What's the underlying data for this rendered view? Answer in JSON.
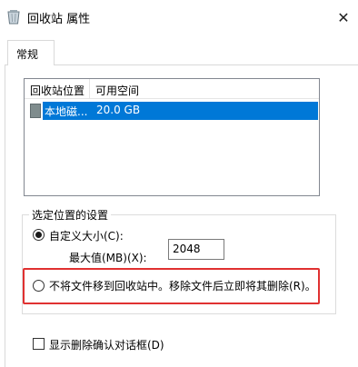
{
  "window": {
    "title": "回收站 属性",
    "close_symbol": "✕"
  },
  "tabs": [
    {
      "label": "常规"
    }
  ],
  "list": {
    "columns": [
      "回收站位置",
      "可用空间"
    ],
    "rows": [
      {
        "name": "本地磁...",
        "space": "20.0 GB",
        "selected": true
      }
    ]
  },
  "settings": {
    "group_label": "选定位置的设置",
    "custom_size_label": "自定义大小(C):",
    "max_label": "最大值(MB)(X):",
    "max_value": "2048",
    "no_move_label": "不将文件移到回收站中。移除文件后立即将其删除(R)。",
    "selected_option": "custom_size"
  },
  "confirm": {
    "label": "显示删除确认对话框(D)",
    "checked": false
  },
  "colors": {
    "selection": "#0078d7",
    "highlight_border": "#e03131"
  },
  "icons": {
    "app": "recycle-bin-icon",
    "drive": "drive-icon"
  }
}
